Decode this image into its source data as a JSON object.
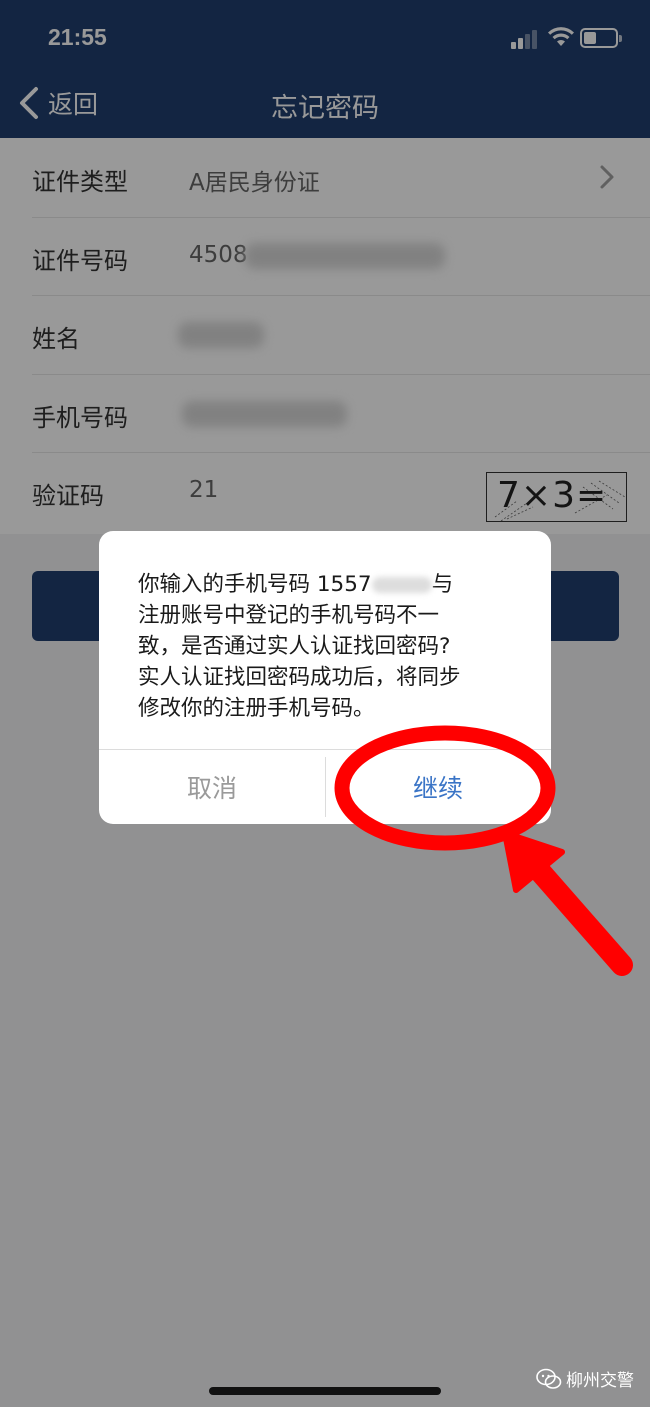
{
  "status_bar": {
    "time": "21:55"
  },
  "nav": {
    "back_label": "返回",
    "title": "忘记密码"
  },
  "form": {
    "rows": [
      {
        "label": "证件类型",
        "value": "A居民身份证"
      },
      {
        "label": "证件号码",
        "value": "4508"
      },
      {
        "label": "姓名",
        "value": ""
      },
      {
        "label": "手机号码",
        "value": ""
      },
      {
        "label": "验证码",
        "value": "21",
        "captcha": "7×3="
      }
    ]
  },
  "dialog": {
    "message_lines": [
      "你输入的手机号码 1557",
      "注册账号中登记的手机号码不一",
      "致，是否通过实人认证找回密码?",
      "实人认证找回密码成功后，将同步",
      "修改你的注册手机号码。"
    ],
    "message_line1_tail": "与",
    "cancel_label": "取消",
    "continue_label": "继续"
  },
  "watermark": {
    "text": "柳州交警"
  },
  "colors": {
    "header_bg": "#213f6e",
    "dialog_button_primary": "#3a74c6",
    "annotation_red": "#ff0000"
  }
}
